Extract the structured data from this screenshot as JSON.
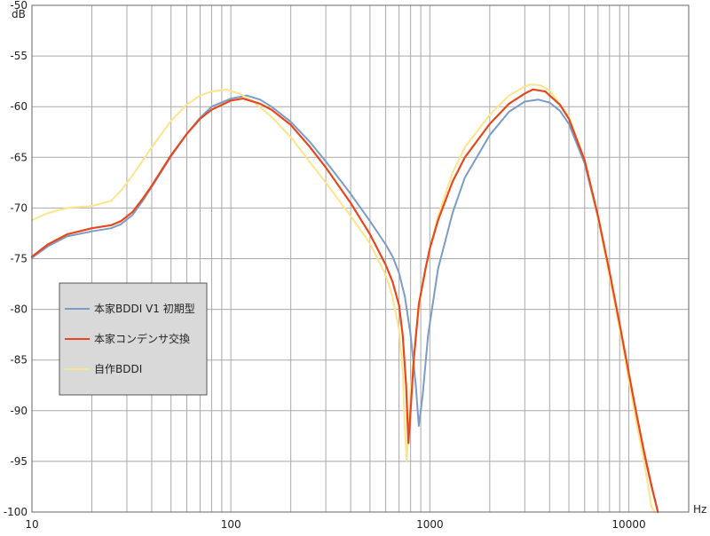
{
  "chart_data": {
    "type": "line",
    "title": "",
    "xlabel": "Hz",
    "ylabel": "dB",
    "xscale": "log",
    "xlim": [
      10,
      20000
    ],
    "ylim": [
      -100,
      -50
    ],
    "x_tick_labels": [
      "10",
      "100",
      "1000",
      "10000"
    ],
    "y_tick_labels": [
      "-50",
      "-55",
      "-60",
      "-65",
      "-70",
      "-75",
      "-80",
      "-85",
      "-90",
      "-95",
      "-100"
    ],
    "grid": true,
    "legend_position": "left",
    "legend_background": "#d9d9d9",
    "series": [
      {
        "name": "本家BDDI V1 初期型",
        "color": "#7a9cc6",
        "points": [
          [
            10,
            -74.9
          ],
          [
            12,
            -73.8
          ],
          [
            15,
            -72.8
          ],
          [
            20,
            -72.3
          ],
          [
            25,
            -72.0
          ],
          [
            28,
            -71.6
          ],
          [
            32,
            -70.7
          ],
          [
            36,
            -69.3
          ],
          [
            40,
            -67.9
          ],
          [
            50,
            -64.9
          ],
          [
            60,
            -62.7
          ],
          [
            70,
            -61.1
          ],
          [
            80,
            -60.0
          ],
          [
            100,
            -59.2
          ],
          [
            120,
            -58.9
          ],
          [
            140,
            -59.3
          ],
          [
            160,
            -60.0
          ],
          [
            200,
            -61.5
          ],
          [
            250,
            -63.5
          ],
          [
            300,
            -65.4
          ],
          [
            400,
            -68.6
          ],
          [
            500,
            -71.3
          ],
          [
            600,
            -73.6
          ],
          [
            650,
            -74.8
          ],
          [
            700,
            -76.4
          ],
          [
            750,
            -78.8
          ],
          [
            800,
            -82.5
          ],
          [
            850,
            -87.5
          ],
          [
            880,
            -91.5
          ],
          [
            920,
            -88.5
          ],
          [
            980,
            -82.5
          ],
          [
            1100,
            -76.0
          ],
          [
            1300,
            -70.5
          ],
          [
            1500,
            -67.0
          ],
          [
            2000,
            -62.8
          ],
          [
            2500,
            -60.5
          ],
          [
            3000,
            -59.5
          ],
          [
            3500,
            -59.3
          ],
          [
            4000,
            -59.6
          ],
          [
            4500,
            -60.4
          ],
          [
            5000,
            -61.7
          ],
          [
            6000,
            -65.6
          ],
          [
            7000,
            -71.0
          ],
          [
            8000,
            -76.5
          ],
          [
            9000,
            -81.8
          ],
          [
            10000,
            -86.5
          ],
          [
            11000,
            -90.8
          ],
          [
            12000,
            -94.5
          ],
          [
            13000,
            -97.5
          ],
          [
            14000,
            -100.0
          ]
        ]
      },
      {
        "name": "本家コンデンサ交換",
        "color": "#e8471c",
        "points": [
          [
            10,
            -74.8
          ],
          [
            12,
            -73.6
          ],
          [
            15,
            -72.6
          ],
          [
            20,
            -72.0
          ],
          [
            25,
            -71.7
          ],
          [
            28,
            -71.3
          ],
          [
            32,
            -70.4
          ],
          [
            36,
            -69.1
          ],
          [
            40,
            -67.8
          ],
          [
            50,
            -64.8
          ],
          [
            60,
            -62.7
          ],
          [
            70,
            -61.2
          ],
          [
            80,
            -60.3
          ],
          [
            100,
            -59.4
          ],
          [
            115,
            -59.2
          ],
          [
            140,
            -59.7
          ],
          [
            160,
            -60.3
          ],
          [
            200,
            -61.8
          ],
          [
            250,
            -64.0
          ],
          [
            300,
            -66.0
          ],
          [
            400,
            -69.5
          ],
          [
            500,
            -72.6
          ],
          [
            600,
            -75.6
          ],
          [
            650,
            -77.3
          ],
          [
            700,
            -79.6
          ],
          [
            730,
            -82.5
          ],
          [
            760,
            -87.5
          ],
          [
            780,
            -93.2
          ],
          [
            800,
            -90.0
          ],
          [
            830,
            -85.0
          ],
          [
            880,
            -79.5
          ],
          [
            950,
            -76.0
          ],
          [
            1000,
            -74.0
          ],
          [
            1100,
            -71.2
          ],
          [
            1300,
            -67.4
          ],
          [
            1500,
            -65.0
          ],
          [
            2000,
            -61.7
          ],
          [
            2500,
            -59.7
          ],
          [
            3000,
            -58.7
          ],
          [
            3300,
            -58.3
          ],
          [
            3800,
            -58.5
          ],
          [
            4500,
            -59.8
          ],
          [
            5000,
            -61.2
          ],
          [
            6000,
            -65.3
          ],
          [
            7000,
            -70.8
          ],
          [
            8000,
            -76.3
          ],
          [
            9000,
            -81.5
          ],
          [
            10000,
            -86.3
          ],
          [
            11000,
            -90.6
          ],
          [
            12000,
            -94.3
          ],
          [
            13000,
            -97.4
          ],
          [
            14000,
            -100.0
          ]
        ]
      },
      {
        "name": "自作BDDI",
        "color": "#fde48a",
        "points": [
          [
            10,
            -71.2
          ],
          [
            12,
            -70.5
          ],
          [
            15,
            -70.0
          ],
          [
            20,
            -69.8
          ],
          [
            25,
            -69.3
          ],
          [
            28,
            -68.3
          ],
          [
            32,
            -66.8
          ],
          [
            40,
            -64.0
          ],
          [
            50,
            -61.4
          ],
          [
            60,
            -59.8
          ],
          [
            70,
            -58.9
          ],
          [
            80,
            -58.5
          ],
          [
            95,
            -58.3
          ],
          [
            110,
            -58.7
          ],
          [
            130,
            -59.5
          ],
          [
            160,
            -61.0
          ],
          [
            200,
            -63.0
          ],
          [
            250,
            -65.5
          ],
          [
            300,
            -67.5
          ],
          [
            400,
            -70.8
          ],
          [
            500,
            -73.5
          ],
          [
            600,
            -76.6
          ],
          [
            650,
            -78.8
          ],
          [
            700,
            -82.0
          ],
          [
            730,
            -86.0
          ],
          [
            750,
            -92.0
          ],
          [
            765,
            -95.0
          ],
          [
            780,
            -92.0
          ],
          [
            800,
            -88.0
          ],
          [
            850,
            -82.5
          ],
          [
            900,
            -78.5
          ],
          [
            1000,
            -74.0
          ],
          [
            1100,
            -70.8
          ],
          [
            1300,
            -66.5
          ],
          [
            1500,
            -64.0
          ],
          [
            2000,
            -60.8
          ],
          [
            2500,
            -58.9
          ],
          [
            3000,
            -58.0
          ],
          [
            3200,
            -57.8
          ],
          [
            3600,
            -57.9
          ],
          [
            4000,
            -58.4
          ],
          [
            5000,
            -61.0
          ],
          [
            6000,
            -65.3
          ],
          [
            7000,
            -71.0
          ],
          [
            8000,
            -76.8
          ],
          [
            9000,
            -82.0
          ],
          [
            10000,
            -87.0
          ],
          [
            11000,
            -91.5
          ],
          [
            12000,
            -95.3
          ],
          [
            13000,
            -99.5
          ],
          [
            13500,
            -100.0
          ]
        ]
      }
    ]
  }
}
